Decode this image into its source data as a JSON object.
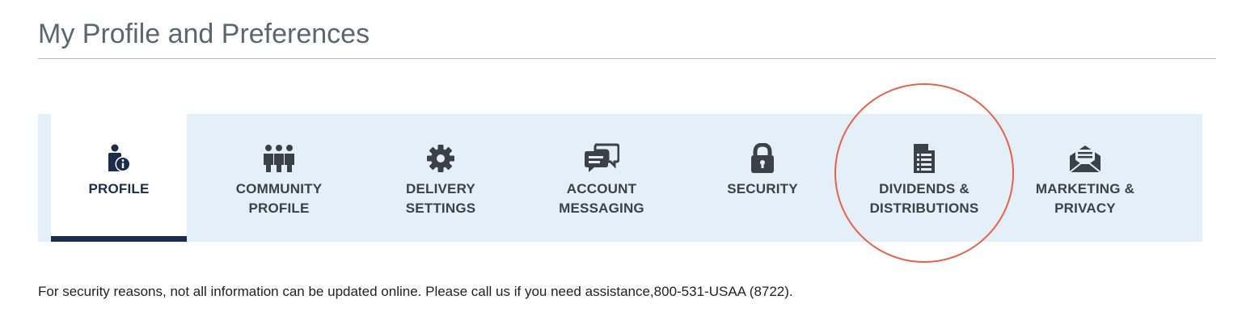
{
  "page": {
    "title": "My Profile and Preferences"
  },
  "tabs": [
    {
      "key": "profile",
      "line1": "PROFILE",
      "line2": "",
      "icon": "person-info-icon",
      "active": true
    },
    {
      "key": "community",
      "line1": "COMMUNITY",
      "line2": "PROFILE",
      "icon": "group-people-icon",
      "active": false
    },
    {
      "key": "delivery",
      "line1": "DELIVERY",
      "line2": "SETTINGS",
      "icon": "gear-icon",
      "active": false
    },
    {
      "key": "messaging",
      "line1": "ACCOUNT",
      "line2": "MESSAGING",
      "icon": "chat-bubbles-icon",
      "active": false
    },
    {
      "key": "security",
      "line1": "SECURITY",
      "line2": "",
      "icon": "lock-icon",
      "active": false
    },
    {
      "key": "dividends",
      "line1": "DIVIDENDS &",
      "line2": "DISTRIBUTIONS",
      "icon": "document-list-icon",
      "active": false
    },
    {
      "key": "marketing",
      "line1": "MARKETING &",
      "line2": "PRIVACY",
      "icon": "envelope-icon",
      "active": false
    }
  ],
  "notice": {
    "text": "For security reasons, not all information can be updated online. Please call us if you need assistance,800-531-USAA (8722)."
  },
  "colors": {
    "tab_bar_bg": "#e5eff8",
    "active_indicator": "#1b2d4a",
    "annotation_circle": "#e5624a",
    "title_text": "#5b6770"
  }
}
